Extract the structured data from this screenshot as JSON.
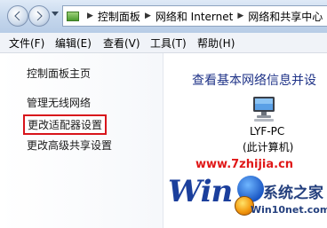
{
  "address": {
    "crumbs": [
      "控制面板",
      "网络和 Internet",
      "网络和共享中心"
    ]
  },
  "menu": {
    "items": [
      "文件(F)",
      "编辑(E)",
      "查看(V)",
      "工具(T)",
      "帮助(H)"
    ]
  },
  "left_pane": {
    "links": {
      "home": "控制面板主页",
      "wireless": "管理无线网络",
      "adapter": "更改适配器设置",
      "sharing": "更改高级共享设置"
    }
  },
  "main": {
    "heading": "查看基本网络信息并设",
    "computer_name": "LYF-PC",
    "computer_sub": "(此计算机)"
  },
  "watermarks": {
    "site": "www.7zhijia.cn",
    "logo": "Win",
    "brand_title": "系统之家",
    "brand_url": "Win10net.com"
  },
  "colors": {
    "highlight_box": "#d8141b",
    "heading": "#1e3287"
  }
}
